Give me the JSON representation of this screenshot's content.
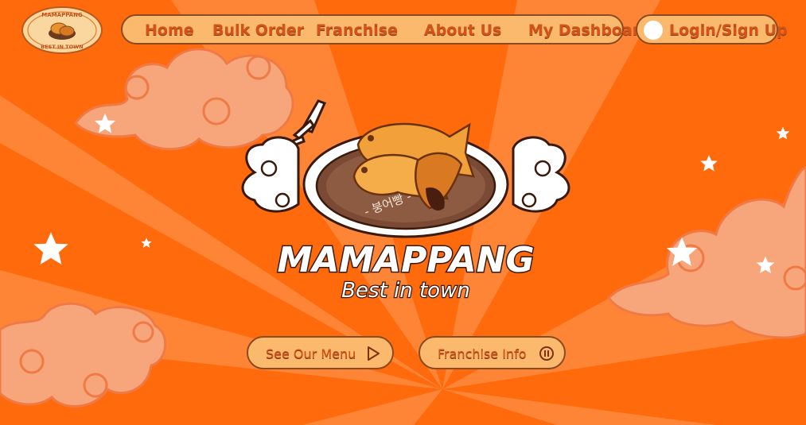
{
  "brand": {
    "badge_top": "MAMAPPANG",
    "badge_bottom": "BEST IN TOWN",
    "hero_title": "MAMAPPANG",
    "hero_subtitle": "Best in town",
    "korean_text": "- 붕어빵 -"
  },
  "nav": {
    "items": [
      {
        "label": "Home"
      },
      {
        "label": "Bulk Order"
      },
      {
        "label": "Franchise"
      },
      {
        "label": "About Us"
      },
      {
        "label": "My Dashboard"
      }
    ],
    "login_label": "Login/Sign Up"
  },
  "actions": {
    "menu_label": "See Our Menu",
    "franchise_label": "Franchise Info"
  },
  "colors": {
    "background": "#ff6a0c",
    "ray": "#ff8a3a",
    "pill": "#fbb96d",
    "pill_border": "#8a4a22",
    "text": "#d2541a",
    "cloud": "#f9a877"
  },
  "icons": [
    "play-triangle-icon",
    "coin-icon",
    "user-avatar-icon"
  ]
}
